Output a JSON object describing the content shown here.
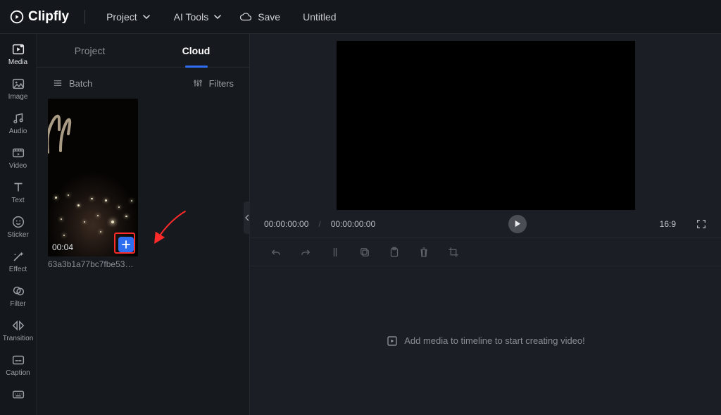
{
  "brand": "Clipfly",
  "topbar": {
    "project_label": "Project",
    "aitools_label": "AI Tools",
    "save_label": "Save",
    "title": "Untitled"
  },
  "rail": [
    {
      "key": "media",
      "label": "Media"
    },
    {
      "key": "image",
      "label": "Image"
    },
    {
      "key": "audio",
      "label": "Audio"
    },
    {
      "key": "video",
      "label": "Video"
    },
    {
      "key": "text",
      "label": "Text"
    },
    {
      "key": "sticker",
      "label": "Sticker"
    },
    {
      "key": "effect",
      "label": "Effect"
    },
    {
      "key": "filter",
      "label": "Filter"
    },
    {
      "key": "transition",
      "label": "Transition"
    },
    {
      "key": "caption",
      "label": "Caption"
    }
  ],
  "panel": {
    "tabs": {
      "project": "Project",
      "cloud": "Cloud"
    },
    "batch_label": "Batch",
    "filters_label": "Filters",
    "thumb": {
      "duration": "00:04",
      "filename": "63a3b1a77bc7fbe53dc13…"
    }
  },
  "player": {
    "current": "00:00:00:00",
    "total": "00:00:00:00",
    "ratio": "16:9"
  },
  "timeline": {
    "hint": "Add media to timeline to start creating video!"
  }
}
